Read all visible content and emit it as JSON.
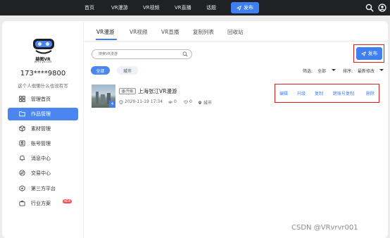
{
  "topnav": {
    "items": [
      "首页",
      "VR漫游",
      "VR视频",
      "VR直播",
      "话题"
    ],
    "publish_label": "发布"
  },
  "sidebar": {
    "logo_text": "赫图VR",
    "logo_sub": "HETU VR.COM",
    "user_phone": "173****9800",
    "user_bio": "这个人很懒什么也没有写",
    "menu": [
      {
        "label": "管理首页",
        "icon": "grid-icon",
        "active": false
      },
      {
        "label": "作品管理",
        "icon": "folder-icon",
        "active": true
      },
      {
        "label": "素材管理",
        "icon": "cube-icon",
        "active": false
      },
      {
        "label": "账号管理",
        "icon": "user-icon",
        "active": false
      },
      {
        "label": "消息中心",
        "icon": "bell-icon",
        "active": false
      },
      {
        "label": "交易中心",
        "icon": "exchange-icon",
        "active": false
      },
      {
        "label": "第三方平台",
        "icon": "platform-icon",
        "active": false
      },
      {
        "label": "行业方案",
        "icon": "briefcase-icon",
        "active": false,
        "badge": "NEW"
      }
    ]
  },
  "main": {
    "tabs": [
      "VR漫游",
      "VR视频",
      "VR直播",
      "复制列表",
      "回收站"
    ],
    "active_tab": 0,
    "search_placeholder": "搜索VR漫游",
    "publish_label": "发布",
    "chips": [
      "全部",
      "城市"
    ],
    "filter_label": "筛选:",
    "filter_value": "全部",
    "sort_label": "排序:",
    "sort_value": "最新修改",
    "card": {
      "thumb_badge": "4",
      "tag": "升级",
      "title": "上海张江VR漫游",
      "date": "2020-11-19 17:34",
      "views": "0",
      "likes": "0",
      "location": "城市"
    },
    "actions": [
      "编辑",
      "升级",
      "复制",
      "跨账号复制",
      "删除"
    ]
  },
  "watermark": "CSDN @VRvrvr001",
  "colors": {
    "accent": "#3f7ff2",
    "topbar": "#1f2124",
    "highlight_box": "#e02020"
  }
}
